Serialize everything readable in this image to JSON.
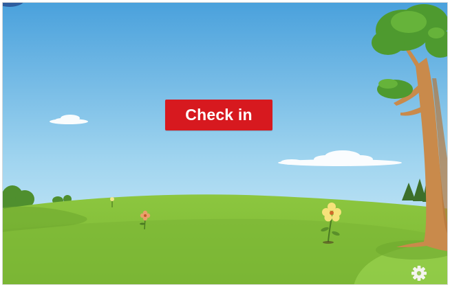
{
  "screen": {
    "checkin_button": {
      "label": "Check in"
    },
    "settings": {
      "icon": "gear-icon"
    }
  },
  "colors": {
    "sky_top": "#4aa1dc",
    "sky_bottom": "#d9f1fa",
    "grass_light": "#8cc63f",
    "grass_dark": "#6ea82e",
    "button_red": "#d7191f",
    "trunk": "#c98a4b",
    "leaves": "#4e9a2f"
  }
}
